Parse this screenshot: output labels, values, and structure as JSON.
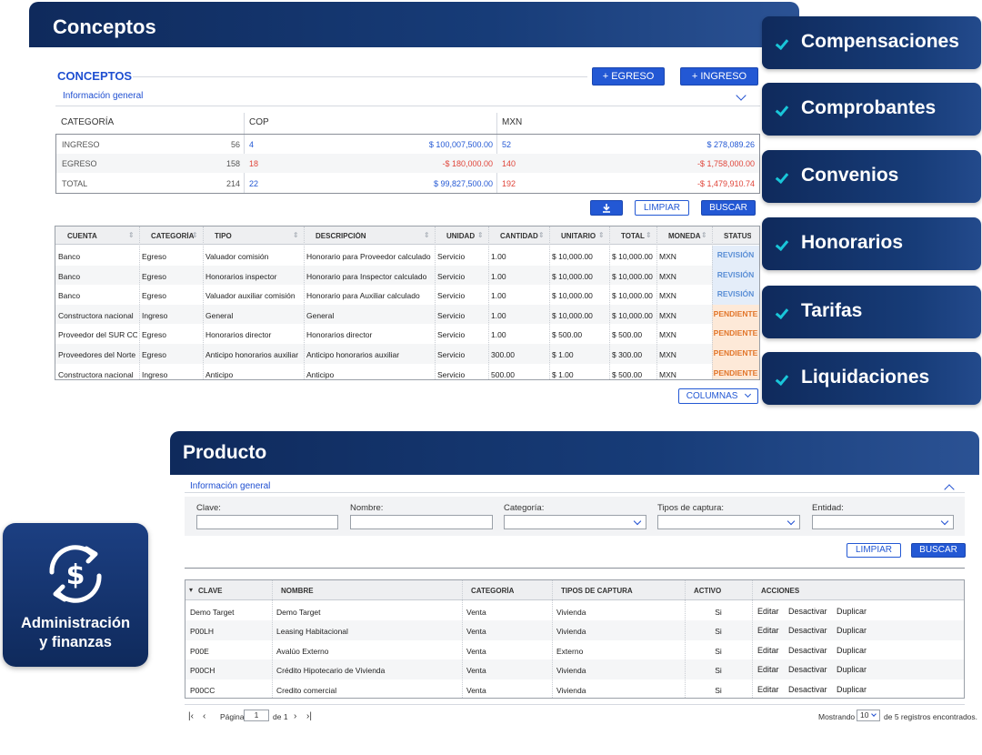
{
  "conceptos": {
    "header_title": "Conceptos",
    "section_title": "CONCEPTOS",
    "btn_egreso": "+ EGRESO",
    "btn_ingreso": "+ INGRESO",
    "info_general": "Información general",
    "summary": {
      "headers": [
        "CATEGORÍA",
        "COP",
        "MXN"
      ],
      "rows": [
        {
          "label": "INGRESO",
          "count": "56",
          "cop_count": "4",
          "cop_amount": "$ 100,007,500.00",
          "mxn_count": "52",
          "mxn_amount": "$ 278,089.26"
        },
        {
          "label": "EGRESO",
          "count": "158",
          "cop_count": "18",
          "cop_amount": "-$ 180,000.00",
          "mxn_count": "140",
          "mxn_amount": "-$ 1,758,000.00"
        },
        {
          "label": "TOTAL",
          "count": "214",
          "cop_count": "22",
          "cop_amount": "$ 99,827,500.00",
          "mxn_count": "192",
          "mxn_amount": "-$ 1,479,910.74"
        }
      ]
    },
    "btn_limpiar": "LIMPIAR",
    "btn_buscar": "BUSCAR",
    "download_icon": "download-icon",
    "table": {
      "headers": [
        "CUENTA",
        "CATEGORÍA",
        "TIPO",
        "DESCRIPCIÓN",
        "UNIDAD",
        "CANTIDAD",
        "UNITARIO",
        "TOTAL",
        "MONEDA",
        "STATUS"
      ],
      "rows": [
        [
          "Banco",
          "Egreso",
          "Valuador comisión",
          "Honorario para Proveedor calculado",
          "Servicio",
          "1.00",
          "$ 10,000.00",
          "$ 10,000.00",
          "MXN",
          "REVISIÓN"
        ],
        [
          "Banco",
          "Egreso",
          "Honorarios inspector",
          "Honorario para Inspector calculado",
          "Servicio",
          "1.00",
          "$ 10,000.00",
          "$ 10,000.00",
          "MXN",
          "REVISIÓN"
        ],
        [
          "Banco",
          "Egreso",
          "Valuador auxiliar comisión",
          "Honorario para Auxiliar calculado",
          "Servicio",
          "1.00",
          "$ 10,000.00",
          "$ 10,000.00",
          "MXN",
          "REVISIÓN"
        ],
        [
          "Constructora nacional",
          "Ingreso",
          "General",
          "General",
          "Servicio",
          "1.00",
          "$ 10,000.00",
          "$ 10,000.00",
          "MXN",
          "PENDIENTE"
        ],
        [
          "Proveedor del SUR CO",
          "Egreso",
          "Honorarios director",
          "Honorarios director",
          "Servicio",
          "1.00",
          "$ 500.00",
          "$ 500.00",
          "MXN",
          "PENDIENTE"
        ],
        [
          "Proveedores del Norte",
          "Egreso",
          "Anticipo honorarios auxiliar",
          "Anticipo honorarios auxiliar",
          "Servicio",
          "300.00",
          "$ 1.00",
          "$ 300.00",
          "MXN",
          "PENDIENTE"
        ],
        [
          "Constructora nacional",
          "Ingreso",
          "Anticipo",
          "Anticipo",
          "Servicio",
          "500.00",
          "$ 1.00",
          "$ 500.00",
          "MXN",
          "PENDIENTE"
        ]
      ]
    },
    "btn_columnas": "COLUMNAS"
  },
  "menu": {
    "items": [
      "Compensaciones",
      "Comprobantes",
      "Convenios",
      "Honorarios",
      "Tarifas",
      "Liquidaciones"
    ]
  },
  "admin_badge": {
    "icon": "currency-exchange-icon",
    "line1": "Administración",
    "line2": "y finanzas"
  },
  "producto": {
    "header_title": "Producto",
    "info_general": "Información general",
    "filters": {
      "clave": "Clave:",
      "nombre": "Nombre:",
      "categoria": "Categoría:",
      "tipos": "Tipos de captura:",
      "entidad": "Entidad:"
    },
    "btn_limpiar": "LIMPIAR",
    "btn_buscar": "BUSCAR",
    "table": {
      "headers": [
        "CLAVE",
        "NOMBRE",
        "CATEGORÍA",
        "TIPOS DE CAPTURA",
        "ACTIVO",
        "ACCIONES"
      ],
      "rows": [
        [
          "Demo Target",
          "Demo Target",
          "Venta",
          "Vivienda",
          "Si"
        ],
        [
          "P00LH",
          "Leasing Habitacional",
          "Venta",
          "Vivienda",
          "Si"
        ],
        [
          "P00E",
          "Avalúo Externo",
          "Venta",
          "Externo",
          "Si"
        ],
        [
          "P00CH",
          "Crédito Hipotecario de Vivienda",
          "Venta",
          "Vivienda",
          "Si"
        ],
        [
          "P00CC",
          "Credito comercial",
          "Venta",
          "Vivienda",
          "Si"
        ]
      ],
      "actions": [
        "Editar",
        "Desactivar",
        "Duplicar"
      ]
    },
    "pagination": {
      "pagina_label": "Página",
      "page_value": "1",
      "of_label": "de 1",
      "mostrando": "Mostrando",
      "page_size": "10",
      "registros": "de 5 registros encontrados."
    }
  },
  "colors": {
    "navy": "#0f2a5c",
    "accent_blue": "#2358d4",
    "negative": "#e0453a",
    "check": "#19c6d9",
    "revision": "#5b8fd6",
    "pendiente": "#e2762b"
  }
}
